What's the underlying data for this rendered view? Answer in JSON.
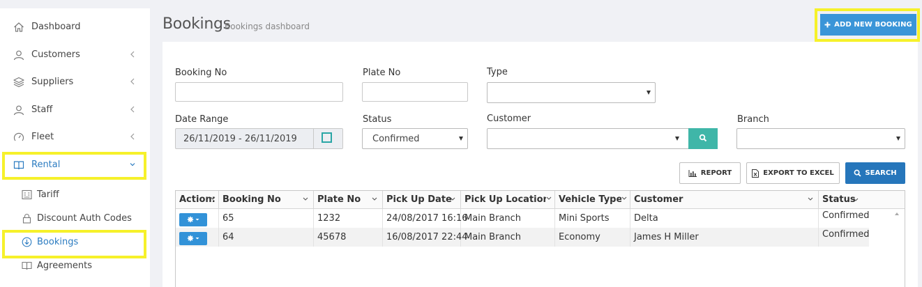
{
  "sidebar": {
    "items": [
      {
        "label": "Dashboard"
      },
      {
        "label": "Customers"
      },
      {
        "label": "Suppliers"
      },
      {
        "label": "Staff"
      },
      {
        "label": "Fleet"
      },
      {
        "label": "Rental"
      }
    ],
    "subitems": [
      {
        "label": "Tariff"
      },
      {
        "label": "Discount Auth Codes"
      },
      {
        "label": "Bookings"
      },
      {
        "label": "Agreements"
      }
    ],
    "accent_color": "#2c7cc1",
    "highlight_color": "#f6f12a"
  },
  "header": {
    "title": "Bookings",
    "subtitle": "Bookings dashboard",
    "add_button": "ADD NEW BOOKING"
  },
  "filters": {
    "booking_no": {
      "label": "Booking No",
      "value": ""
    },
    "plate_no": {
      "label": "Plate No",
      "value": ""
    },
    "type": {
      "label": "Type",
      "value": ""
    },
    "date_range": {
      "label": "Date Range",
      "value": "26/11/2019 - 26/11/2019"
    },
    "status": {
      "label": "Status",
      "value": "Confirmed"
    },
    "customer": {
      "label": "Customer",
      "value": ""
    },
    "branch": {
      "label": "Branch",
      "value": ""
    }
  },
  "toolbar": {
    "report": "REPORT",
    "export": "EXPORT TO EXCEL",
    "search": "SEARCH"
  },
  "table": {
    "columns": [
      "Action:",
      "Booking No",
      "Plate No",
      "Pick Up Date",
      "Pick Up Location",
      "Vehicle Type",
      "Customer",
      "Status"
    ],
    "rows": [
      {
        "booking_no": "65",
        "plate_no": "1232",
        "pickup_date": "24/08/2017 16:16",
        "pickup_location": "Main Branch",
        "vehicle_type": "Mini Sports",
        "customer": "Delta",
        "status": "Confirmed"
      },
      {
        "booking_no": "64",
        "plate_no": "45678",
        "pickup_date": "16/08/2017 22:44",
        "pickup_location": "Main Branch",
        "vehicle_type": "Economy",
        "customer": "James H Miller",
        "status": "Confirmed"
      }
    ]
  }
}
